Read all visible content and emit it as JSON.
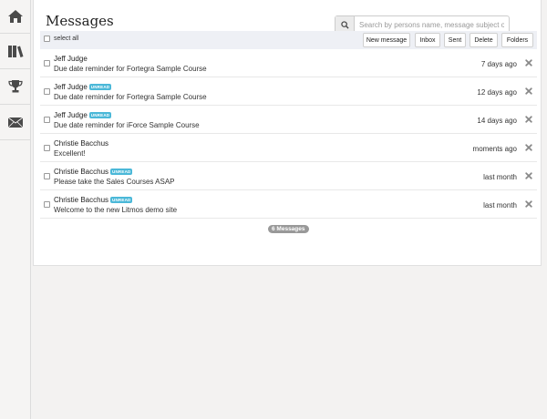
{
  "sidebar": {
    "items": [
      {
        "icon": "home-icon"
      },
      {
        "icon": "books-icon"
      },
      {
        "icon": "trophy-icon"
      },
      {
        "icon": "mail-icon"
      }
    ]
  },
  "header": {
    "title": "Messages",
    "search_placeholder": "Search by persons name, message subject or tags",
    "search_value": ""
  },
  "toolbar": {
    "select_all_label": "select all",
    "buttons": {
      "new_message": "New message",
      "inbox": "Inbox",
      "sent": "Sent",
      "delete": "Delete",
      "folders": "Folders"
    }
  },
  "unread_label": "UNREAD",
  "messages": [
    {
      "sender": "Jeff Judge",
      "unread": false,
      "subject": "Due date reminder for Fortegra Sample Course",
      "time": "7 days ago"
    },
    {
      "sender": "Jeff Judge",
      "unread": true,
      "subject": "Due date reminder for Fortegra Sample Course",
      "time": "12 days ago"
    },
    {
      "sender": "Jeff Judge",
      "unread": true,
      "subject": "Due date reminder for iForce Sample Course",
      "time": "14 days ago"
    },
    {
      "sender": "Christie Bacchus",
      "unread": false,
      "subject": "Excellent!",
      "time": "moments ago"
    },
    {
      "sender": "Christie Bacchus",
      "unread": true,
      "subject": "Please take the Sales Courses ASAP",
      "time": "last month"
    },
    {
      "sender": "Christie Bacchus",
      "unread": true,
      "subject": "Welcome to the new Litmos demo site",
      "time": "last month"
    }
  ],
  "footer": {
    "count_label": "6 Messages"
  },
  "colors": {
    "unread_badge": "#4bb8d8",
    "toolbar_bg": "#eef0f5",
    "icon": "#4a4a4a"
  }
}
